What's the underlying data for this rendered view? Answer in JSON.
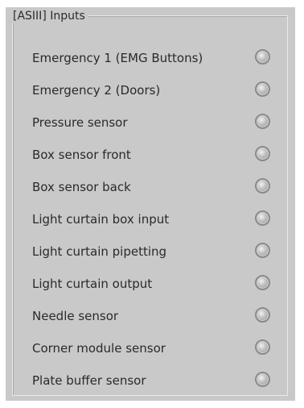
{
  "group": {
    "title": "[ASIII] Inputs"
  },
  "inputs": [
    {
      "label": "Emergency 1 (EMG Buttons)",
      "state": "off"
    },
    {
      "label": "Emergency 2 (Doors)",
      "state": "off"
    },
    {
      "label": "Pressure sensor",
      "state": "off"
    },
    {
      "label": "Box sensor front",
      "state": "off"
    },
    {
      "label": "Box sensor back",
      "state": "off"
    },
    {
      "label": "Light curtain box input",
      "state": "off"
    },
    {
      "label": "Light curtain pipetting",
      "state": "off"
    },
    {
      "label": "Light curtain output",
      "state": "off"
    },
    {
      "label": "Needle sensor",
      "state": "off"
    },
    {
      "label": "Corner module sensor",
      "state": "off"
    },
    {
      "label": "Plate buffer sensor",
      "state": "off"
    }
  ],
  "colors": {
    "panel_background": "#c9c9c9",
    "indicator_off": "#a9a9a9",
    "text": "#2a2a2a"
  },
  "icons": {
    "indicator": "status-led-icon"
  }
}
